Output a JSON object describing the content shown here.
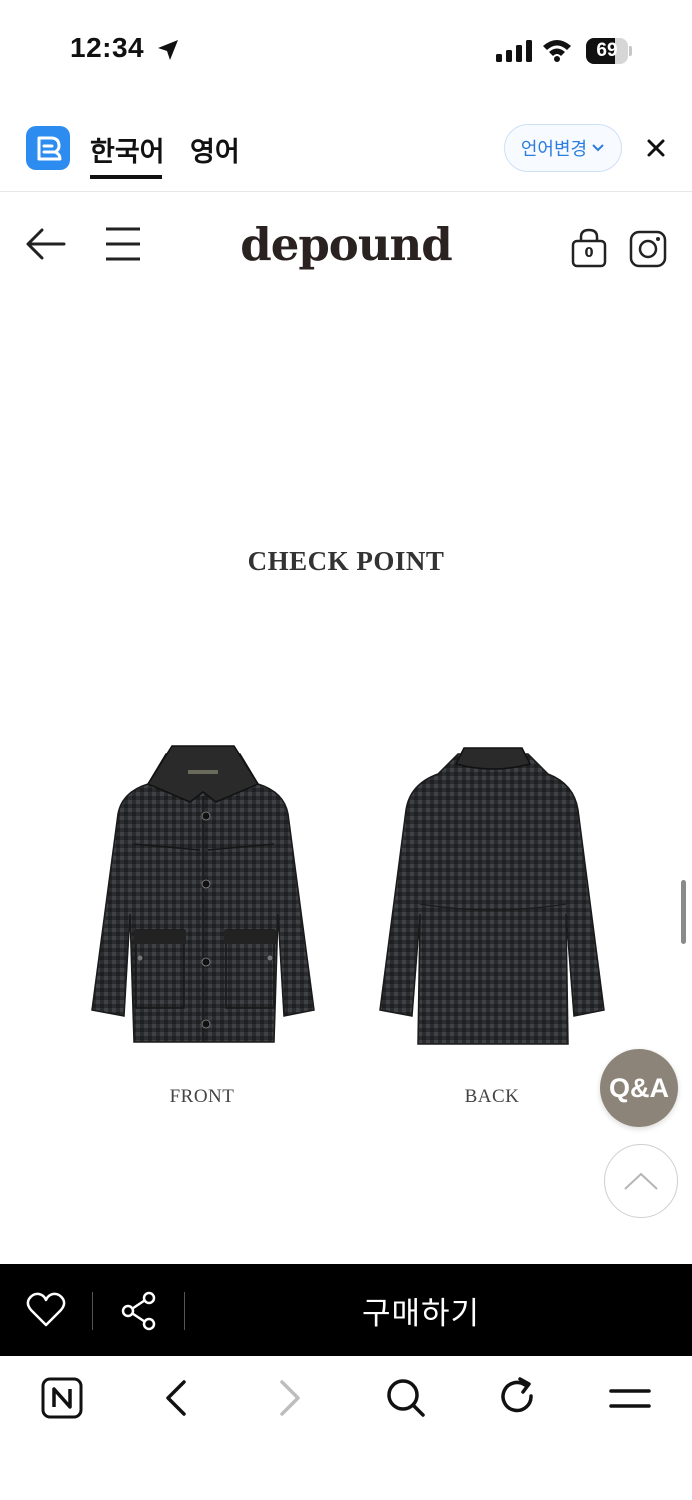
{
  "status_bar": {
    "time": "12:34",
    "battery": "69",
    "battery_level": 0.69
  },
  "translate_bar": {
    "tabs": [
      {
        "label": "한국어",
        "active": true
      },
      {
        "label": "영어",
        "active": false
      }
    ],
    "change_language_label": "언어변경",
    "accent_color": "#2d7de0"
  },
  "header": {
    "brand": "depound",
    "cart_count": "0"
  },
  "content": {
    "title": "CHECK POINT",
    "front_caption": "FRONT",
    "back_caption": "BACK"
  },
  "floating": {
    "qa_label": "Q&A"
  },
  "purchase_bar": {
    "buy_label": "구매하기"
  },
  "icons": {
    "status": [
      "location-arrow-icon",
      "signal-icon",
      "wifi-icon",
      "battery-icon"
    ],
    "header": [
      "back-arrow-icon",
      "menu-icon",
      "shopping-bag-icon",
      "instagram-icon"
    ],
    "browser_nav": [
      "naver-home-icon",
      "browser-back-icon",
      "browser-forward-icon",
      "search-icon",
      "reload-icon",
      "browser-menu-icon"
    ]
  }
}
